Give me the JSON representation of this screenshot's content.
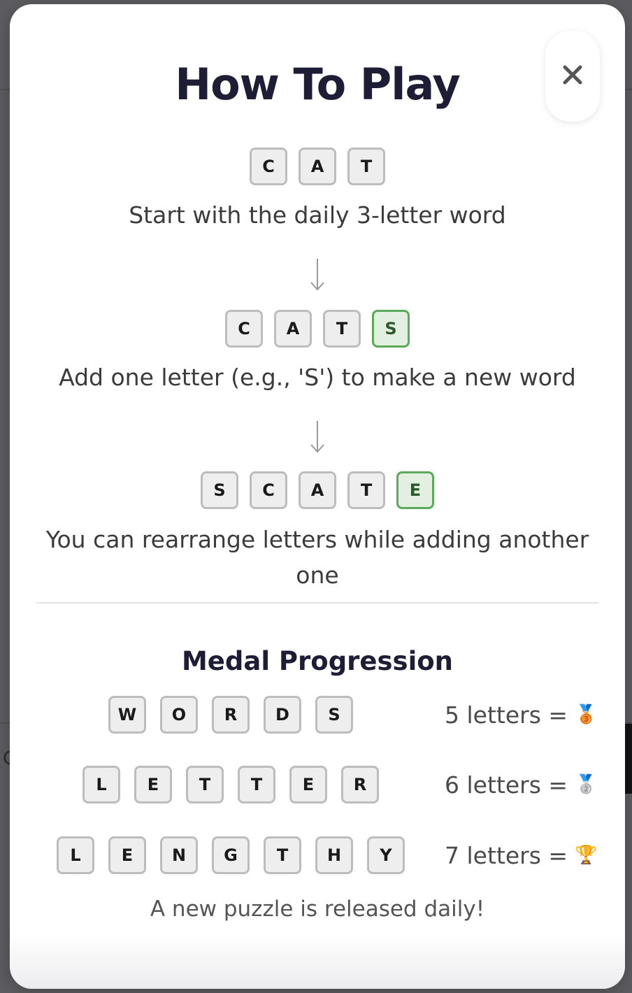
{
  "modal": {
    "title": "How To Play",
    "close_icon": "close-icon"
  },
  "steps": [
    {
      "tiles": [
        {
          "letter": "C",
          "new": false
        },
        {
          "letter": "A",
          "new": false
        },
        {
          "letter": "T",
          "new": false
        }
      ],
      "caption": "Start with the daily 3-letter word"
    },
    {
      "tiles": [
        {
          "letter": "C",
          "new": false
        },
        {
          "letter": "A",
          "new": false
        },
        {
          "letter": "T",
          "new": false
        },
        {
          "letter": "S",
          "new": true
        }
      ],
      "caption": "Add one letter (e.g., 'S') to make a new word"
    },
    {
      "tiles": [
        {
          "letter": "S",
          "new": false
        },
        {
          "letter": "C",
          "new": false
        },
        {
          "letter": "A",
          "new": false
        },
        {
          "letter": "T",
          "new": false
        },
        {
          "letter": "E",
          "new": true
        }
      ],
      "caption": "You can rearrange letters while adding another one"
    }
  ],
  "medal_section": {
    "title": "Medal Progression",
    "rows": [
      {
        "letters": [
          "W",
          "O",
          "R",
          "D",
          "S"
        ],
        "label": "5 letters =",
        "medal": "🥉",
        "medal_icon": "bronze-medal-icon"
      },
      {
        "letters": [
          "L",
          "E",
          "T",
          "T",
          "E",
          "R"
        ],
        "label": "6 letters =",
        "medal": "🥈",
        "medal_icon": "silver-medal-icon"
      },
      {
        "letters": [
          "L",
          "E",
          "N",
          "G",
          "T",
          "H",
          "Y"
        ],
        "label": "7 letters =",
        "medal": "🏆",
        "medal_icon": "trophy-icon"
      }
    ]
  },
  "footer": {
    "note": "A new puzzle is released daily!"
  },
  "colors": {
    "title": "#1d1d35",
    "tile_border": "#bdbdbd",
    "tile_bg": "#eeeeee",
    "new_tile_border": "#5aaa5a",
    "new_tile_text": "#2c5a2c"
  }
}
